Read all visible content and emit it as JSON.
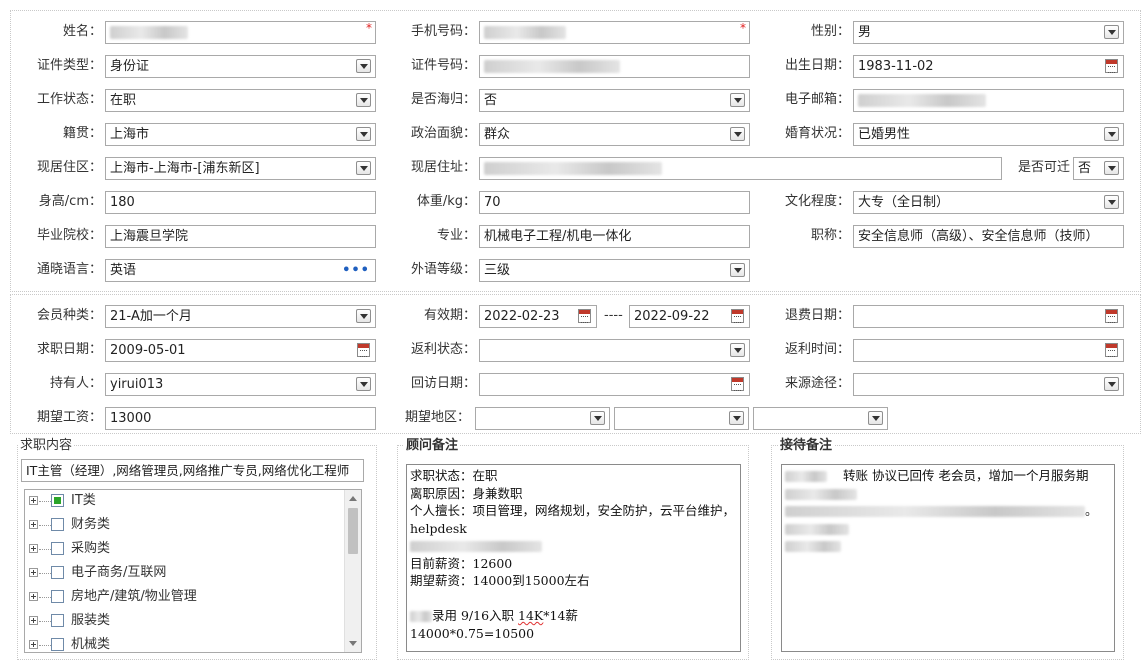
{
  "basic": {
    "name_label": "姓名：",
    "phone_label": "手机号码：",
    "gender_label": "性别：",
    "gender_value": "男",
    "id_type_label": "证件类型：",
    "id_type_value": "身份证",
    "id_number_label": "证件号码：",
    "birth_label": "出生日期：",
    "birth_value": "1983-11-02",
    "work_status_label": "工作状态：",
    "work_status_value": "在职",
    "overseas_label": "是否海归：",
    "overseas_value": "否",
    "email_label": "电子邮箱：",
    "native_label": "籍贯：",
    "native_value": "上海市",
    "political_label": "政治面貌：",
    "political_value": "群众",
    "marital_label": "婚育状况：",
    "marital_value": "已婚男性",
    "residence_area_label": "现居住区：",
    "residence_area_value": "上海市-上海市-[浦东新区]",
    "address_label": "现居住址：",
    "relocate_label": "是否可迁",
    "relocate_value": "否",
    "height_label": "身高/cm：",
    "height_value": "180",
    "weight_label": "体重/kg：",
    "weight_value": "70",
    "education_label": "文化程度：",
    "education_value": "大专（全日制）",
    "school_label": "毕业院校：",
    "school_value": "上海震旦学院",
    "major_label": "专业：",
    "major_value": "机械电子工程/机电一体化",
    "title_label": "职称：",
    "title_value": "安全信息师（高级）、安全信息师（技师）",
    "language_label": "通晓语言：",
    "language_value": "英语",
    "language_more": "•••",
    "foreign_level_label": "外语等级：",
    "foreign_level_value": "三级",
    "required_mark": "*"
  },
  "member": {
    "member_type_label": "会员种类：",
    "member_type_value": "21-A加一个月",
    "valid_label": "有效期：",
    "valid_start": "2022-02-23",
    "valid_sep": "----",
    "valid_end": "2022-09-22",
    "refund_date_label": "退费日期：",
    "job_date_label": "求职日期：",
    "job_date_value": "2009-05-01",
    "rebate_status_label": "返利状态：",
    "rebate_time_label": "返利时间：",
    "holder_label": "持有人：",
    "holder_value": "yirui013",
    "visit_date_label": "回访日期：",
    "source_label": "来源途径：",
    "salary_label": "期望工资：",
    "salary_value": "13000",
    "region_label": "期望地区："
  },
  "job_content": {
    "title": "求职内容",
    "summary": "IT主管（经理）,网络管理员,网络推广专员,网络优化工程师",
    "tree": [
      {
        "label": "IT类",
        "checked": true
      },
      {
        "label": "财务类",
        "checked": false
      },
      {
        "label": "采购类",
        "checked": false
      },
      {
        "label": "电子商务/互联网",
        "checked": false
      },
      {
        "label": "房地产/建筑/物业管理",
        "checked": false
      },
      {
        "label": "服装类",
        "checked": false
      },
      {
        "label": "机械类",
        "checked": false
      }
    ]
  },
  "advisor_notes": {
    "title": "顾问备注",
    "l1": "求职状态：在职",
    "l2": "离职原因：身兼数职",
    "l3": "个人擅长：项目管理，网络规划，安全防护，云平台维护，helpdesk",
    "l5": "目前薪资：12600",
    "l6": "期望薪资：14000到15000左右",
    "l8_a": "录用 9/16入职 ",
    "l8_b": "14K",
    "l8_c": "*14薪",
    "l9": "14000*0.75=10500"
  },
  "reception_notes": {
    "title": "接待备注",
    "line1": "转账  协议已回传  老会员，增加一个月服务期",
    "period_mark": "。"
  }
}
